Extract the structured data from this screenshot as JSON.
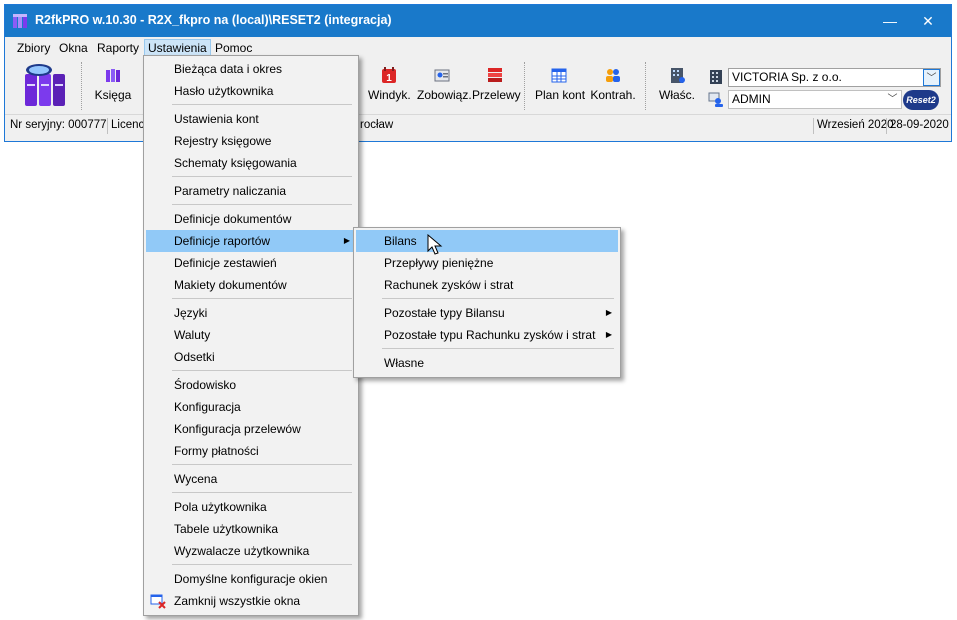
{
  "window": {
    "title": "R2fkPRO w.10.30 - R2X_fkpro na (local)\\RESET2 (integracja)",
    "minimize": "—",
    "close": "✕"
  },
  "menubar": [
    "Zbiory",
    "Okna",
    "Raporty",
    "Ustawienia",
    "Pomoc"
  ],
  "toolbar": {
    "ksiega": "Księga",
    "windyk": "Windyk.",
    "zobowiaz": "Zobowiąz.",
    "przelewy": "Przelewy",
    "plan_kont": "Plan kont",
    "kontrah": "Kontrah.",
    "wlasc": "Właśc.",
    "company": "VICTORIA Sp. z o.o.",
    "user": "ADMIN",
    "logo": "Reset2"
  },
  "statusbar": {
    "serial": "Nr seryjny: 000777",
    "licence": "Licencj",
    "city": "rocław",
    "month": "Wrzesień 2020",
    "date": "28-09-2020"
  },
  "ustawienia_menu": [
    "Bieżąca data i okres",
    "Hasło użytkownika",
    "Ustawienia kont",
    "Rejestry księgowe",
    "Schematy księgowania",
    "Parametry naliczania",
    "Definicje dokumentów",
    "Definicje raportów",
    "Definicje zestawień",
    "Makiety dokumentów",
    "Języki",
    "Waluty",
    "Odsetki",
    "Środowisko",
    "Konfiguracja",
    "Konfiguracja przelewów",
    "Formy płatności",
    "Wycena",
    "Pola użytkownika",
    "Tabele użytkownika",
    "Wyzwalacze użytkownika",
    "Domyślne konfiguracje okien",
    "Zamknij wszystkie okna"
  ],
  "raporty_submenu": [
    "Bilans",
    "Przepływy pieniężne",
    "Rachunek zysków i strat",
    "Pozostałe typy Bilansu",
    "Pozostałe typu Rachunku zysków i strat",
    "Własne"
  ],
  "icons": {
    "submenu_arrow": "▶",
    "combo_arrow": "﹀"
  },
  "colors": {
    "titlebar": "#1979ca",
    "highlight": "#91c9f7",
    "menu_active": "#cce4f7"
  }
}
